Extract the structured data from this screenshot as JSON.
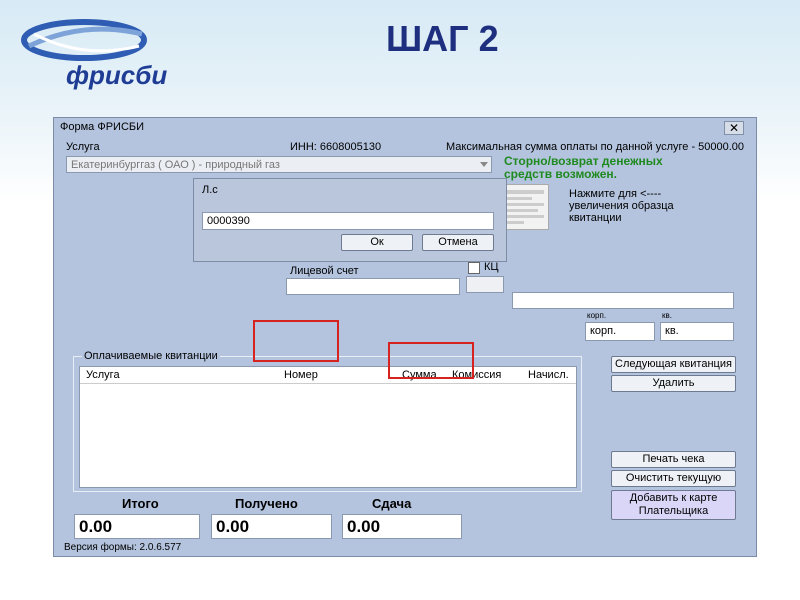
{
  "slide": {
    "title": "ШАГ 2",
    "logo_text": "фрисби"
  },
  "window": {
    "title": "Форма ФРИСБИ",
    "close_glyph": "✕",
    "service_label": "Услуга",
    "inn_text": "ИНН: 6608005130",
    "max_sum_text": "Максимальная сумма оплаты по данной услуге - 50000.00",
    "service_value": "Екатеринбурггаз ( ОАО ) - природный газ",
    "refund_text": "Сторно/возврат денежных средств возможен.",
    "receipt_hint": "Нажмите для <---- увеличения образца квитанции",
    "account_label": "Лицевой счет",
    "kc_label": "КЦ",
    "korp_small": "корп.",
    "kv_small": "кв.",
    "korp_field": "корп.",
    "kv_field": "кв.",
    "group_label": "Оплачиваемые квитанции",
    "columns": [
      "Услуга",
      "Номер",
      "Сумма",
      "Комиссия",
      "Начисл."
    ],
    "buttons": {
      "next": "Следующая квитанция",
      "delete": "Удалить",
      "print": "Печать чека",
      "clear": "Очистить текущую",
      "add": "Добавить к карте Плательщика"
    },
    "totals": {
      "itogo_label": "Итого",
      "itogo_value": "0.00",
      "received_label": "Получено",
      "received_value": "0.00",
      "change_label": "Сдача",
      "change_value": "0.00"
    },
    "version": "Версия формы: 2.0.6.577"
  },
  "dialog": {
    "title": "Л.с",
    "input_value": "0000390",
    "ok_label": "Ок",
    "cancel_label": "Отмена"
  },
  "colors": {
    "title_blue": "#1d2f7e",
    "highlight_red": "#d6231f",
    "refund_green": "#1f8a1f"
  }
}
